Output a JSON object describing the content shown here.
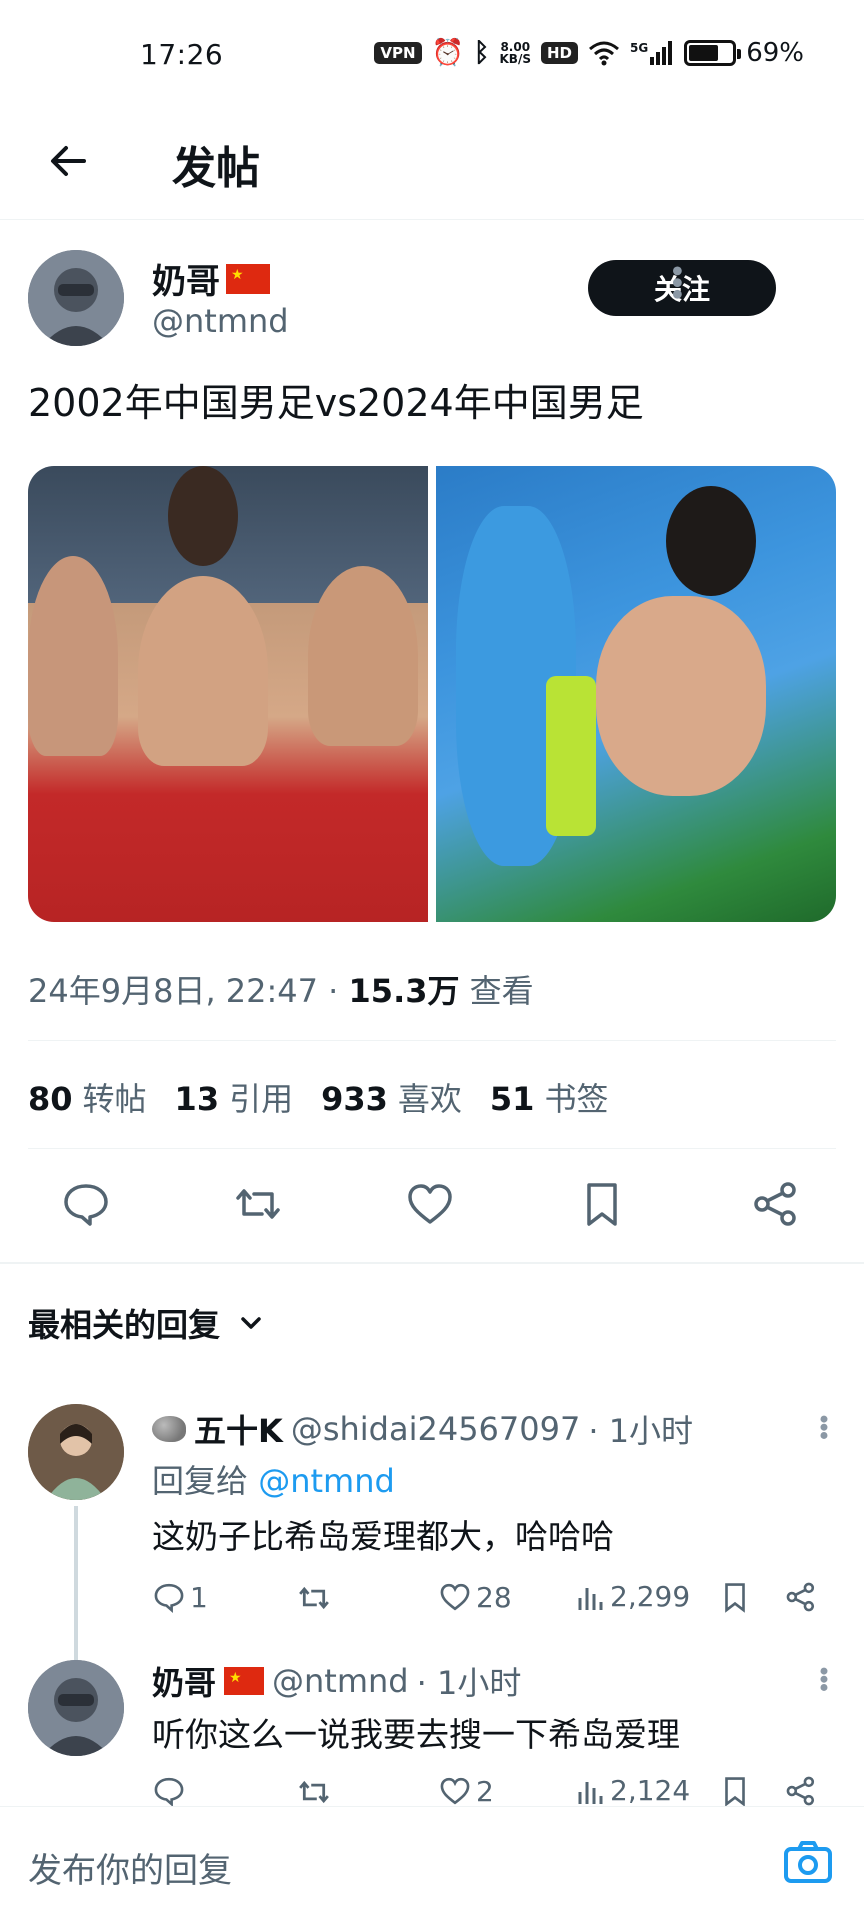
{
  "status_bar": {
    "time": "17:26",
    "vpn": "VPN",
    "net_speed_top": "8.00",
    "net_speed_bottom": "KB/S",
    "hd": "HD",
    "signal": "5G",
    "battery": "69%",
    "battery_level": 0.69
  },
  "header": {
    "title": "发帖"
  },
  "post": {
    "author_name": "奶哥",
    "author_handle": "@ntmnd",
    "follow_label": "关注",
    "text": "2002年中国男足vs2024年中国男足",
    "timestamp": "24年9月8日, 22:47 · ",
    "views_count": "15.3万",
    "views_label": " 查看",
    "stats": [
      {
        "count": "80",
        "label": "转帖"
      },
      {
        "count": "13",
        "label": "引用"
      },
      {
        "count": "933",
        "label": "喜欢"
      },
      {
        "count": "51",
        "label": "书签"
      }
    ]
  },
  "replies_header": "最相关的回复",
  "replies": [
    {
      "name": "五十K",
      "handle": "@shidai24567097",
      "time": " · 1小时",
      "reply_to_label": "回复给 ",
      "reply_to_handle": "@ntmnd",
      "text": "这奶子比希岛爱理都大，哈哈哈",
      "comments": "1",
      "likes": "28",
      "views": "2,299"
    },
    {
      "name": "奶哥",
      "handle": "@ntmnd",
      "time": " · 1小时",
      "text": "听你这么一说我要去搜一下希岛爱理",
      "likes": "2",
      "views": "2,124"
    }
  ],
  "reply_bar": {
    "placeholder": "发布你的回复"
  },
  "colors": {
    "accent": "#1d9bf0",
    "text": "#0f1419",
    "secondary": "#536471"
  }
}
